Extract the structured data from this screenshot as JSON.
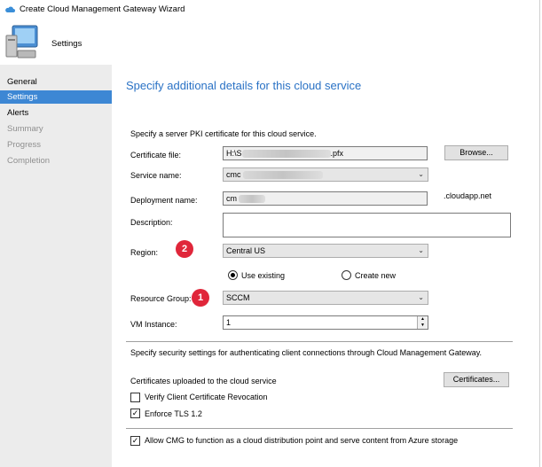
{
  "window": {
    "title": "Create Cloud Management Gateway Wizard"
  },
  "header": {
    "title": "Settings"
  },
  "nav": {
    "items": [
      {
        "label": "General",
        "state": "normal"
      },
      {
        "label": "Settings",
        "state": "selected"
      },
      {
        "label": "Alerts",
        "state": "normal"
      },
      {
        "label": "Summary",
        "state": "disabled"
      },
      {
        "label": "Progress",
        "state": "disabled"
      },
      {
        "label": "Completion",
        "state": "disabled"
      }
    ]
  },
  "page": {
    "heading": "Specify additional details for this cloud service",
    "pki_intro": "Specify a server PKI certificate for this cloud service.",
    "certificate_file": {
      "label": "Certificate file:",
      "prefix": "H:\\S",
      "suffix": ".pfx"
    },
    "browse_button": "Browse...",
    "service_name": {
      "label": "Service name:",
      "value": "cmc"
    },
    "deployment_name": {
      "label": "Deployment name:",
      "value": "cm",
      "suffix": ".cloudapp.net"
    },
    "description": {
      "label": "Description:",
      "value": ""
    },
    "region": {
      "label": "Region:",
      "value": "Central US"
    },
    "use_existing": "Use existing",
    "create_new": "Create new",
    "resource_group": {
      "label": "Resource Group:",
      "value": "SCCM"
    },
    "vm_instance": {
      "label": "VM Instance:",
      "value": "1"
    },
    "security_intro": "Specify security settings for authenticating client connections through Cloud Management Gateway.",
    "certs_uploaded": "Certificates uploaded to the cloud service",
    "certificates_button": "Certificates...",
    "verify_revocation": {
      "label": "Verify Client Certificate Revocation",
      "checked": false
    },
    "enforce_tls": {
      "label": "Enforce TLS 1.2",
      "checked": true
    },
    "allow_cmg": {
      "label": "Allow CMG to function as a cloud distribution point and serve content from Azure storage",
      "checked": true
    }
  },
  "annotations": {
    "badge_region": "2",
    "badge_resource_group": "1"
  },
  "colors": {
    "accent": "#3d87d4",
    "heading": "#2a72c5",
    "badge": "#e0263a"
  }
}
